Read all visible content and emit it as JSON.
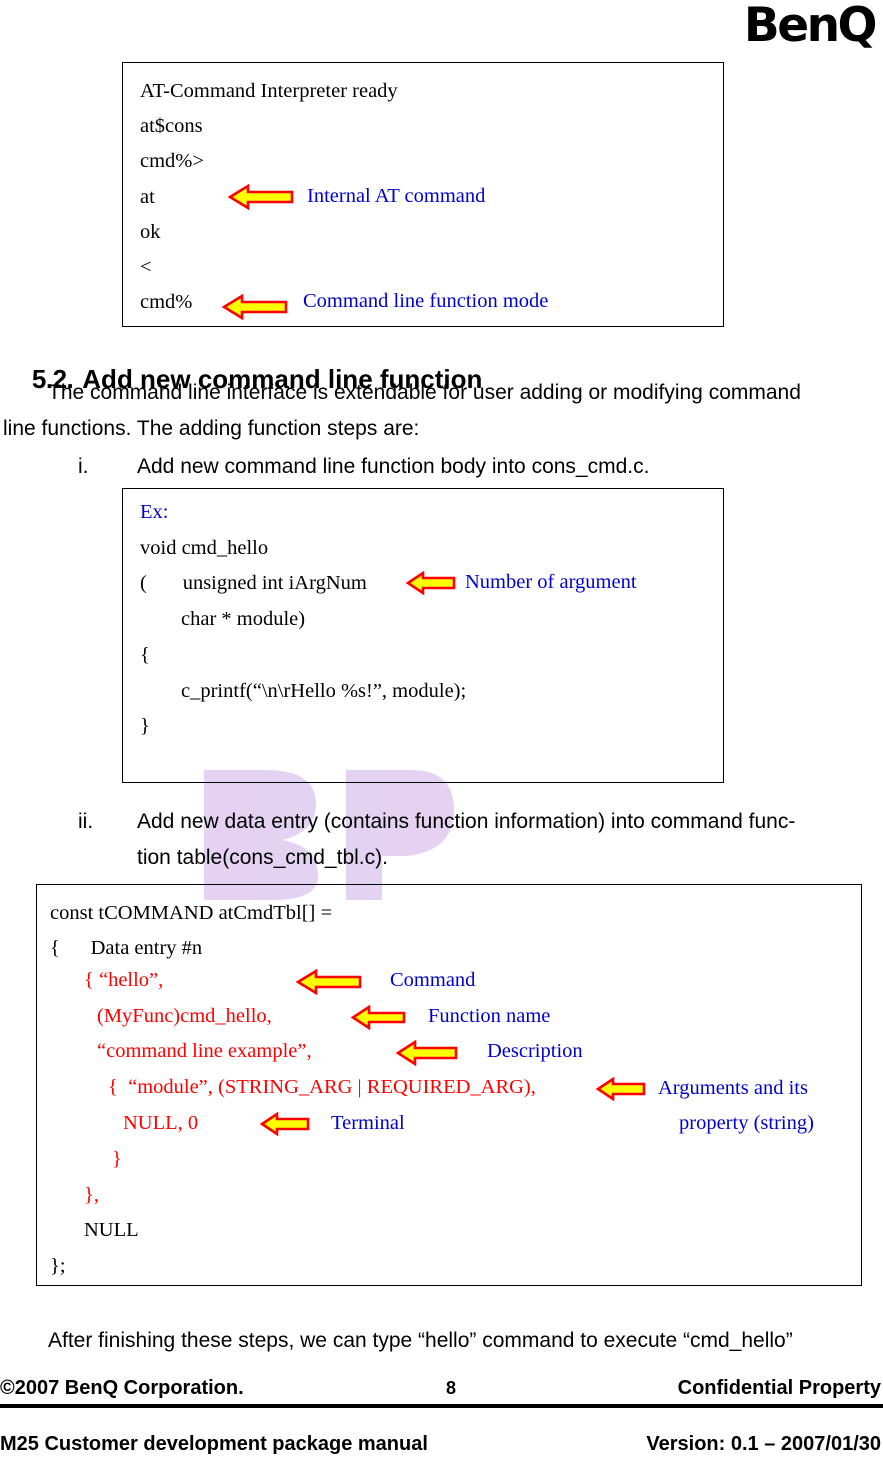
{
  "brand": {
    "logo_text": "BenQ"
  },
  "terminal_box": {
    "lines": [
      "AT-Command Interpreter ready",
      "at$cons",
      "cmd%>",
      "at",
      "ok",
      "<",
      "cmd%"
    ],
    "annotations": [
      "Internal AT command",
      "Command line function mode"
    ]
  },
  "section": {
    "number": "5.2.",
    "title": "Add new command line function",
    "paragraph_line1": "The command line interface is extendable for user adding or modifying command",
    "paragraph_line2": "line functions. The adding function steps are:"
  },
  "steps": [
    {
      "marker": "i.",
      "text": "Add new command line function body into cons_cmd.c."
    },
    {
      "marker": "ii.",
      "line1": "Add new data entry (contains function information) into command func-",
      "line2": "tion table(cons_cmd_tbl.c)."
    }
  ],
  "example_box": {
    "label": "Ex:",
    "lines": [
      "void cmd_hello",
      "(       unsigned int iArgNum",
      "        char * module)",
      "{",
      "        c_printf(“\\n\\rHello %s!”, module);",
      "}"
    ],
    "annotations": [
      "Number of argument"
    ]
  },
  "table_box": {
    "lines": [
      "const tCOMMAND atCmdTbl[] =",
      "{      Data entry #n",
      "{ “hello”,",
      "(MyFunc)cmd_hello,",
      "“command line example”,",
      "{  “module”, (STRING_ARG | REQUIRED_ARG),",
      "NULL, 0",
      "}",
      "},",
      "NULL",
      "};"
    ],
    "annotations": [
      "Command",
      "Function name",
      "Description",
      "Arguments and its",
      "property (string)",
      "Terminal"
    ]
  },
  "closing_text": "After finishing these steps, we can type “hello” command to execute “cmd_hello”",
  "footer": {
    "copyright": "©2007 BenQ Corporation.",
    "page_number": "8",
    "classification": "Confidential Property",
    "manual_title": "M25 Customer development package manual",
    "version": "Version: 0.1 – 2007/01/30"
  },
  "colors": {
    "annotation_blue": "#0000d0",
    "code_red": "#ff0000",
    "arrow_fill": "#ffff00",
    "arrow_stroke": "#ff0000",
    "watermark": "#d8b8e8"
  }
}
